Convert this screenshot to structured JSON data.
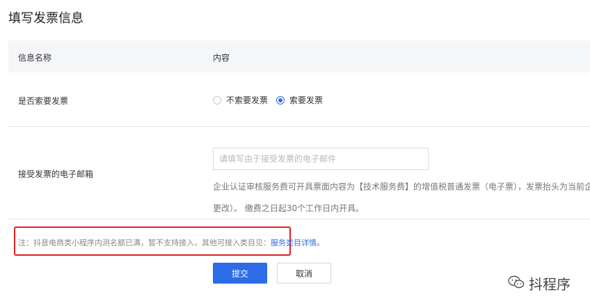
{
  "page": {
    "title": "填写发票信息"
  },
  "table": {
    "headers": {
      "name": "信息名称",
      "content": "内容"
    },
    "invoice_row": {
      "label": "是否索要发票",
      "options": [
        {
          "label": "不索要发票",
          "checked": false
        },
        {
          "label": "索要发票",
          "checked": true
        }
      ]
    },
    "email_row": {
      "label": "接受发票的电子邮箱",
      "placeholder": "请填写由于接受发票的电子邮件",
      "value": "",
      "help_line1": "企业认证审核服务费可开具票面内容为【技术服务费】的增值税普通发票（电子票），发票抬头为当前企",
      "help_line2": "更改）。 缴费之日起30个工作日内开具。"
    }
  },
  "notice": {
    "text": "注：抖音电商类小程序内测名额已满，暂不支持接入，其他可接入类目见：",
    "link": "服务类目详情。"
  },
  "buttons": {
    "submit": "提交",
    "cancel": "取消"
  },
  "watermark": {
    "text": "抖程序"
  },
  "colors": {
    "primary": "#2d6ce8",
    "highlight_border": "#e02020",
    "header_bg": "#f5f6f8"
  }
}
